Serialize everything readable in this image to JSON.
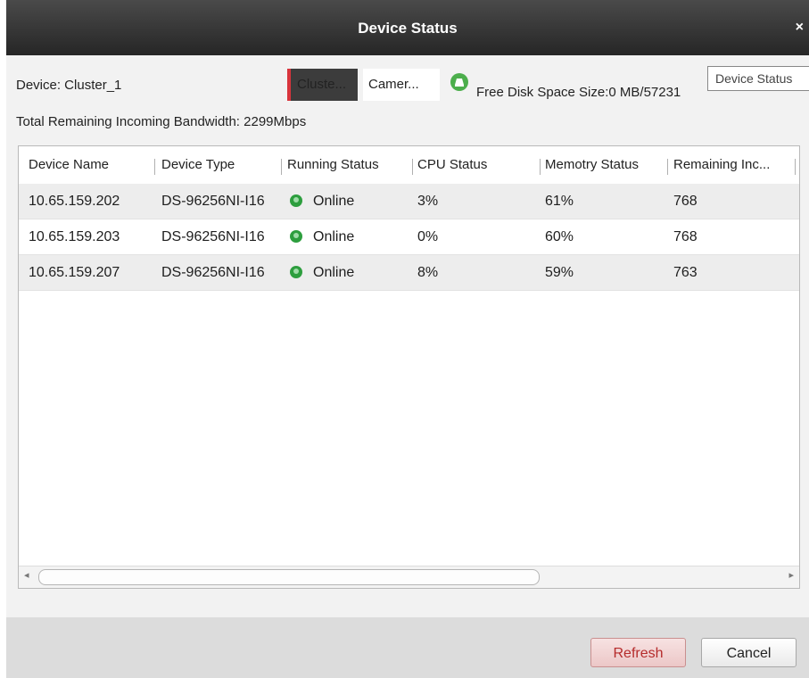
{
  "window": {
    "title": "Device Status",
    "close_glyph": "×"
  },
  "device": {
    "label": "Device: Cluster_1"
  },
  "tabs": [
    {
      "label": "Cluste...",
      "selected": true
    },
    {
      "label": "Camer...",
      "selected": false
    }
  ],
  "disk": {
    "icon": "disk-status-icon",
    "text": "Free Disk Space Size:0 MB/57231"
  },
  "tooltip": {
    "text": "Device Status"
  },
  "bandwidth": {
    "text": "Total Remaining Incoming Bandwidth: 2299Mbps"
  },
  "table": {
    "columns": [
      "Device Name",
      "Device Type",
      "Running Status",
      "CPU Status",
      "Memotry Status",
      "Remaining Inc..."
    ],
    "rows": [
      {
        "name": "10.65.159.202",
        "type": "DS-96256NI-I16",
        "status": "Online",
        "cpu": "3%",
        "memory": "61%",
        "remaining": "768"
      },
      {
        "name": "10.65.159.203",
        "type": "DS-96256NI-I16",
        "status": "Online",
        "cpu": "0%",
        "memory": "60%",
        "remaining": "768"
      },
      {
        "name": "10.65.159.207",
        "type": "DS-96256NI-I16",
        "status": "Online",
        "cpu": "8%",
        "memory": "59%",
        "remaining": "763"
      }
    ]
  },
  "buttons": {
    "refresh": "Refresh",
    "cancel": "Cancel"
  },
  "colors": {
    "accent_red": "#d8343c",
    "online_green": "#2d9e3e",
    "titlebar": "#2f2f2f"
  }
}
